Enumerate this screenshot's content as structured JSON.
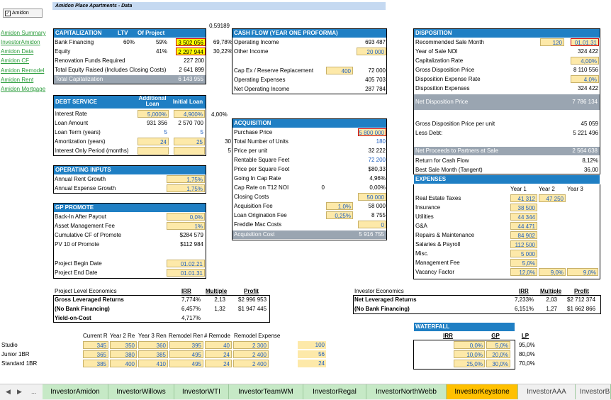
{
  "top": {
    "checkbox_label": "Amidon",
    "sheet_title": "Amidon Place Apartments - Data",
    "ratio": "0,59189"
  },
  "links": [
    "Amidon Summary",
    "InvestorAmidon",
    "Amidon Data",
    "Amidon CF",
    "Amidon Remodel",
    "Amidon Rent",
    "Amidon Mortgage"
  ],
  "cap": {
    "title": "CAPITALIZATION",
    "ltv": "LTV",
    "of_project": "Of Project",
    "rows": [
      {
        "label": "Bank Financing",
        "ltv": "60%",
        "pct": "59%",
        "amt": "3 502 056",
        "pp": "69,78%"
      },
      {
        "label": "Equity",
        "ltv": "",
        "pct": "41%",
        "amt": "2 297 944",
        "pp": "30,22%"
      },
      {
        "label": "Renovation Funds Required",
        "ltv": "",
        "pct": "",
        "amt": "227 200",
        "pp": ""
      },
      {
        "label": "Total Equity Raised (Includes Closing Costs)",
        "ltv": "",
        "pct": "",
        "amt": "2 641 899",
        "pp": ""
      }
    ],
    "total_label": "Total Capitalization",
    "total_amt": "6 143 955"
  },
  "cashflow": {
    "title": "CASH FLOW (YEAR ONE PROFORMA)",
    "rows": [
      {
        "label": "Operating Income",
        "in": "",
        "val": "693 487"
      },
      {
        "label": "Other Income",
        "in": "",
        "val": "20 000"
      },
      {
        "label": "",
        "in": "",
        "val": ""
      },
      {
        "label": "Cap Ex / Reserve Replacement",
        "in": "400",
        "val": "72 000"
      },
      {
        "label": "Operating Expenses",
        "in": "",
        "val": "405 703"
      },
      {
        "label": "Net Operating Income",
        "in": "",
        "val": "287 784"
      }
    ]
  },
  "disposition": {
    "title": "DISPOSITION",
    "rows": [
      {
        "label": "Recommended Sale Month",
        "in": "120",
        "val": "01.01.31"
      },
      {
        "label": "Year of Sale NOI",
        "in": "",
        "val": "324 422"
      },
      {
        "label": "Capitalization Rate",
        "in": "",
        "val": "4,00%"
      },
      {
        "label": "Gross Disposition Price",
        "in": "",
        "val": "8 110 556"
      },
      {
        "label": "Disposition Expense Rate",
        "in": "",
        "val": "4,0%"
      },
      {
        "label": "Disposition Expenses",
        "in": "",
        "val": "324 422"
      }
    ],
    "net_label": "Net Disposition Price",
    "net_val": "7 786 134",
    "rows2": [
      {
        "label": "Gross Disposition Price per unit",
        "val": "45 059"
      },
      {
        "label": "Less Debt:",
        "val": "5 221 496"
      }
    ],
    "proceeds_label": "Net Proceeds to Partners at Sale",
    "proceeds_val": "2 564 638",
    "rows3": [
      {
        "label": "Return for Cash Flow",
        "val": "8,12%"
      },
      {
        "label": "Best Sale Month (Tangent)",
        "val": "36,00"
      }
    ]
  },
  "debt": {
    "title": "DEBT SERVICE",
    "col1": "Additional Loan",
    "col2": "Initial Loan",
    "side": "4,00%",
    "rows": [
      {
        "label": "Interest Rate",
        "a": "5,000%",
        "b": "4,900%"
      },
      {
        "label": "Loan Amount",
        "a": "931 356",
        "b": "2 570 700"
      },
      {
        "label": "Loan Term (years)",
        "a": "5",
        "b": "5"
      },
      {
        "label": "Amortization (years)",
        "a": "24",
        "b": "25"
      },
      {
        "label": "Interest Only Period (months)",
        "a": "",
        "b": ""
      }
    ]
  },
  "acq": {
    "title": "ACQUISITION",
    "rows": [
      {
        "label": "Purchase Price",
        "pre": "",
        "in": "",
        "val": "5 800 000"
      },
      {
        "label": "Total Number of Units",
        "pre": "30",
        "in": "",
        "val": "180"
      },
      {
        "label": "Price per unit",
        "pre": "5",
        "in": "",
        "val": "32 222"
      },
      {
        "label": "Rentable Square Feet",
        "pre": "",
        "in": "",
        "val": "72 200"
      },
      {
        "label": "Price per Square Foot",
        "pre": "",
        "in": "",
        "val": "$80,33"
      },
      {
        "label": "Going In Cap Rate",
        "pre": "",
        "in": "",
        "val": "4,96%"
      },
      {
        "label": "Cap Rate on T12 NOI",
        "pre": "",
        "in": "",
        "val": "0,00%"
      },
      {
        "label": "Closing Costs",
        "pre": "",
        "in": "",
        "val": "50 000"
      },
      {
        "label": "Acquisition Fee",
        "pre": "",
        "in": "1,0%",
        "val": "58 000"
      },
      {
        "label": "Loan Origination Fee",
        "pre": "",
        "in": "0,25%",
        "val": "8 755"
      },
      {
        "label": "Freddie Mac Costs",
        "pre": "",
        "in": "",
        "val": "0"
      }
    ],
    "zero": "0",
    "total_label": "Acquisition Cost",
    "total_val": "5 916 755"
  },
  "opinputs": {
    "title": "OPERATING INPUTS",
    "rows": [
      {
        "label": "Annual Rent Growth",
        "val": "1,75%"
      },
      {
        "label": "Annual Expense Growth",
        "val": "1,75%"
      }
    ]
  },
  "expenses": {
    "title": "EXPENSES",
    "y1": "Year 1",
    "y2": "Year 2",
    "y3": "Year 3",
    "rows": [
      {
        "label": "Real Estate Taxes",
        "a": "41 312",
        "b": "47 250",
        "c": ""
      },
      {
        "label": "Insurance",
        "a": "38 500",
        "b": "",
        "c": ""
      },
      {
        "label": "Utilities",
        "a": "44 344",
        "b": "",
        "c": ""
      },
      {
        "label": "G&A",
        "a": "44 471",
        "b": "",
        "c": ""
      },
      {
        "label": "Repairs & Maintenance",
        "a": "84 902",
        "b": "",
        "c": ""
      },
      {
        "label": "Salaries & Payroll",
        "a": "112 500",
        "b": "",
        "c": ""
      },
      {
        "label": "Misc.",
        "a": "5 000",
        "b": "",
        "c": ""
      },
      {
        "label": "Management Fee",
        "a": "5,0%",
        "b": "",
        "c": ""
      },
      {
        "label": "Vacancy Factor",
        "a": "12,0%",
        "b": "9,0%",
        "c": "9,0%"
      }
    ]
  },
  "gp": {
    "title": "GP PROMOTE",
    "rows": [
      {
        "label": "Back-In After Payout",
        "val": "0,0%"
      },
      {
        "label": "Asset Management Fee",
        "val": "1%"
      },
      {
        "label": "Cumulative CF of Promote",
        "val": "$284 579"
      },
      {
        "label": "PV 10 of Promote",
        "val": "$112 984"
      }
    ],
    "rows2": [
      {
        "label": "Project Begin Date",
        "val": "01.02.21"
      },
      {
        "label": "Project End Date",
        "val": "01.01.31"
      }
    ]
  },
  "econ": {
    "title": "Project Level Economics",
    "irr": "IRR",
    "mult": "Multiple",
    "profit": "Profit",
    "rows": [
      {
        "label": "Gross Leveraged Returns",
        "irr": "7,774%",
        "mult": "2,13",
        "profit": "$2 996 953"
      },
      {
        "label": "(No Bank Financing)",
        "irr": "6,457%",
        "mult": "1,32",
        "profit": "$1 947 445"
      },
      {
        "label": "Yield-on-Cost",
        "irr": "4,717%",
        "mult": "",
        "profit": ""
      }
    ]
  },
  "inv": {
    "title": "Investor Economics",
    "irr": "IRR",
    "mult": "Multiple",
    "profit": "Profit",
    "rows": [
      {
        "label": "Net Leveraged Returns",
        "irr": "7,233%",
        "mult": "2,03",
        "profit": "$2 712 374"
      },
      {
        "label": "(No Bank Financing)",
        "irr": "6,151%",
        "mult": "1,27",
        "profit": "$1 662 866"
      }
    ]
  },
  "rent": {
    "headers": [
      "Current R",
      "Year 2 Re",
      "Year 3 Ren",
      "Remodel Ren",
      "# Remode",
      "Remodel Expense"
    ],
    "rows": [
      {
        "label": "Studio",
        "v": [
          "345",
          "350",
          "360",
          "395",
          "40",
          "2 300"
        ],
        "n": "100"
      },
      {
        "label": "Junior 1BR",
        "v": [
          "365",
          "380",
          "385",
          "495",
          "24",
          "2 400"
        ],
        "n": "56"
      },
      {
        "label": "Standard 1BR",
        "v": [
          "385",
          "400",
          "410",
          "495",
          "24",
          "2 400"
        ],
        "n": "24"
      }
    ]
  },
  "waterfall": {
    "title": "WATERFALL",
    "irr": "IRR",
    "gp": "GP",
    "lp": "LP",
    "rows": [
      {
        "irr": "0,0%",
        "gp": "5,0%",
        "lp": "95,0%"
      },
      {
        "irr": "10,0%",
        "gp": "20,0%",
        "lp": "80,0%"
      },
      {
        "irr": "25,0%",
        "gp": "30,0%",
        "lp": "70,0%"
      }
    ]
  },
  "tabs": [
    "InvestorAmidon",
    "InvestorWillows",
    "InvestorWTI",
    "InvestorTeamWM",
    "InvestorRegal",
    "InvestorNorthWebb",
    "InvestorKeystone",
    "InvestorAAA",
    "InvestorB"
  ],
  "nav": {
    "prev": "◀",
    "next": "▶",
    "more": "..."
  },
  "colors": {
    "header": "#1f7fc4",
    "input": "#fde9a9",
    "active_tab": "#ffc000",
    "tab": "#c6e9c6",
    "link": "#2e9e3e"
  }
}
